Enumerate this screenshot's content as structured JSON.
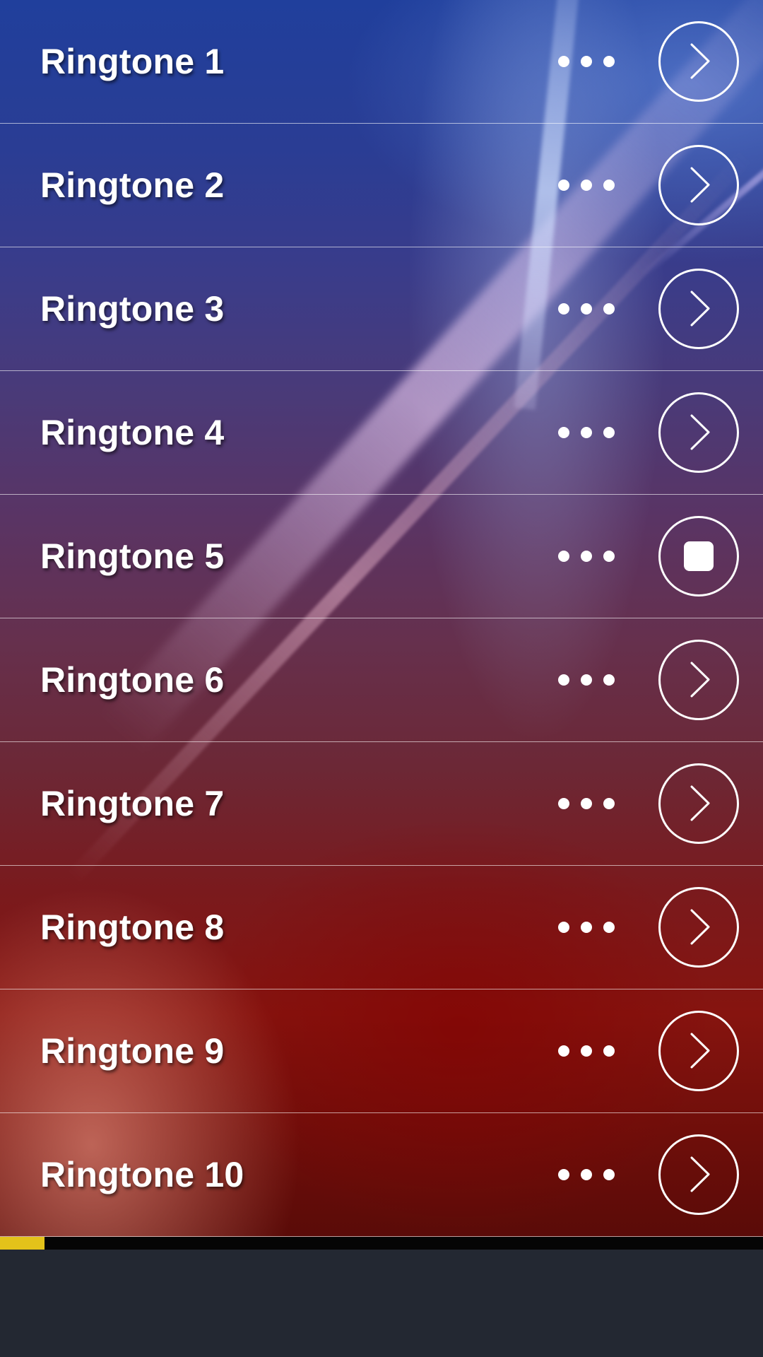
{
  "ringtones": [
    {
      "label": "Ringtone 1",
      "state": "play"
    },
    {
      "label": "Ringtone 2",
      "state": "play"
    },
    {
      "label": "Ringtone 3",
      "state": "play"
    },
    {
      "label": "Ringtone 4",
      "state": "play"
    },
    {
      "label": "Ringtone 5",
      "state": "stop"
    },
    {
      "label": "Ringtone 6",
      "state": "play"
    },
    {
      "label": "Ringtone 7",
      "state": "play"
    },
    {
      "label": "Ringtone 8",
      "state": "play"
    },
    {
      "label": "Ringtone 9",
      "state": "play"
    },
    {
      "label": "Ringtone 10",
      "state": "play"
    }
  ],
  "icons": {
    "more": "more-horizontal-icon",
    "play": "chevron-right-circle-icon",
    "stop": "stop-icon"
  },
  "playback": {
    "progress_fraction": 0.058
  },
  "colors": {
    "progress_fill": "#e3c21a",
    "progress_track": "#050505",
    "bottom_bar": "#232832",
    "text": "#ffffff"
  }
}
